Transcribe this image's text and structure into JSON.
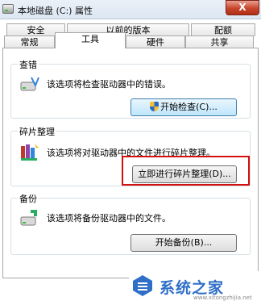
{
  "window": {
    "title": "本地磁盘 (C:) 属性",
    "close_glyph": "X"
  },
  "tabs_back": [
    "安全",
    "以前的版本",
    "配额"
  ],
  "tabs_front": [
    "常规",
    "工具",
    "硬件",
    "共享"
  ],
  "active_tab": "工具",
  "groups": {
    "error_check": {
      "title": "查错",
      "desc": "该选项将检查驱动器中的错误。",
      "button": "开始检查(C)..."
    },
    "defrag": {
      "title": "碎片整理",
      "desc": "该选项将对驱动器中的文件进行碎片整理。",
      "button": "立即进行碎片整理(D)..."
    },
    "backup": {
      "title": "备份",
      "desc": "该选项将备份驱动器中的文件。",
      "button": "开始备份(B)..."
    }
  },
  "icons": {
    "title": "drive-icon",
    "error_check": "disk-check-icon",
    "defrag": "defrag-icon",
    "backup": "backup-icon",
    "shield": "uac-shield-icon"
  },
  "watermark": {
    "text": "系统之家",
    "url": "www.xitongzhijia.net"
  },
  "colors": {
    "highlight": "#d40f0f",
    "watermark": "#2f6fc8"
  }
}
